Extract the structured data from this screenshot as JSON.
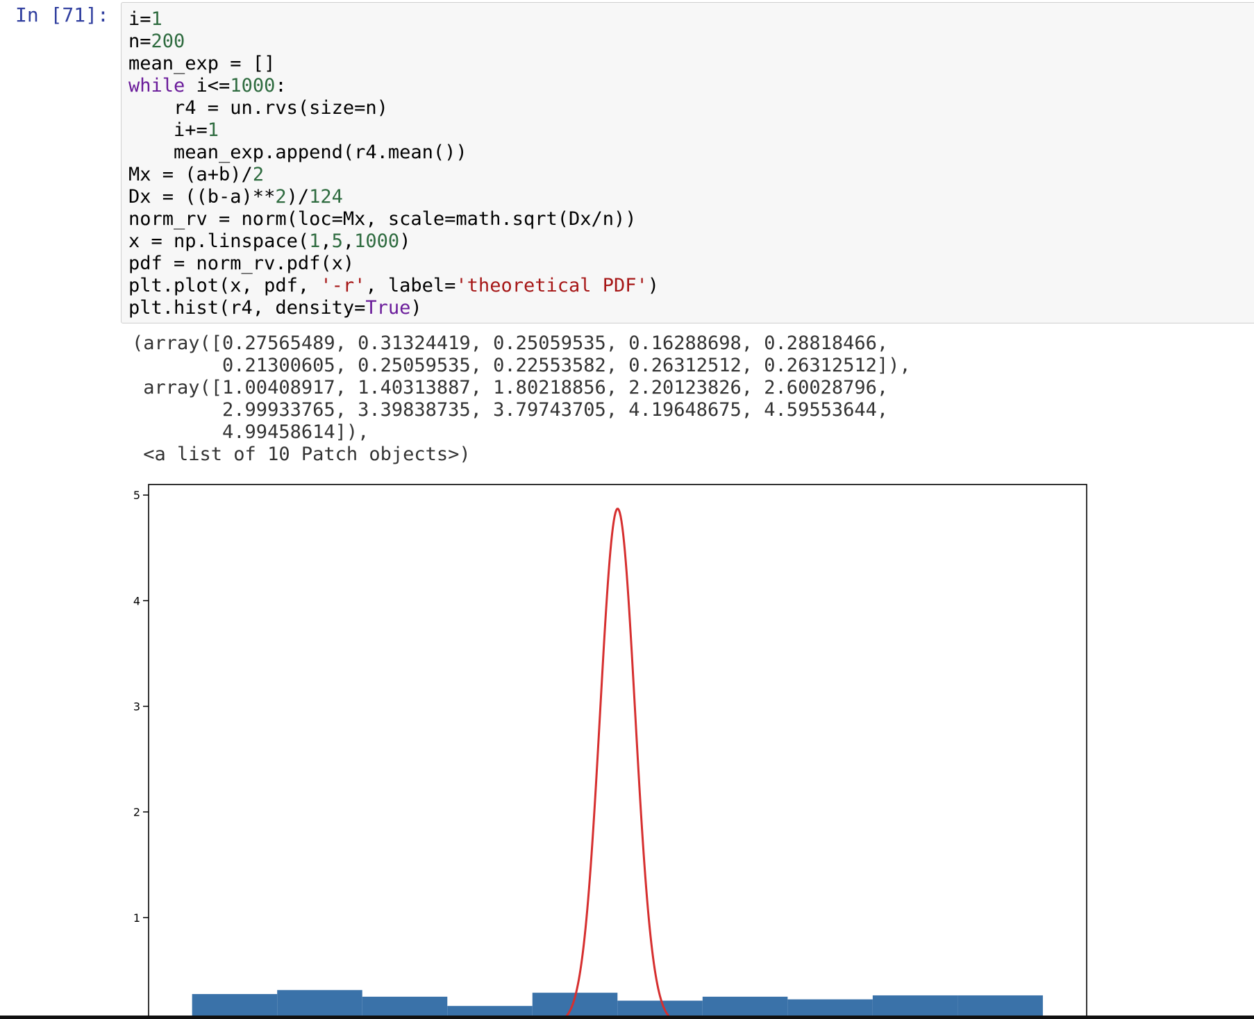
{
  "cell": {
    "prompt": "In [71]:"
  },
  "code": {
    "lines": [
      [
        {
          "t": "i="
        },
        {
          "t": "1",
          "c": "num"
        }
      ],
      [
        {
          "t": "n="
        },
        {
          "t": "200",
          "c": "num"
        }
      ],
      [
        {
          "t": "mean_exp = []"
        }
      ],
      [
        {
          "t": "while",
          "c": "kw"
        },
        {
          "t": " i<="
        },
        {
          "t": "1000",
          "c": "num"
        },
        {
          "t": ":"
        }
      ],
      [
        {
          "t": "    r4 = un.rvs(size=n)"
        }
      ],
      [
        {
          "t": "    i+="
        },
        {
          "t": "1",
          "c": "num"
        }
      ],
      [
        {
          "t": "    mean_exp.append(r4.mean())"
        }
      ],
      [
        {
          "t": "Mx = (a+b)/"
        },
        {
          "t": "2",
          "c": "num"
        }
      ],
      [
        {
          "t": "Dx = ((b-a)**"
        },
        {
          "t": "2",
          "c": "num"
        },
        {
          "t": ")/"
        },
        {
          "t": "124",
          "c": "num"
        }
      ],
      [
        {
          "t": "norm_rv = norm(loc=Mx, scale=math.sqrt(Dx/n))"
        }
      ],
      [
        {
          "t": "x = np.linspace("
        },
        {
          "t": "1",
          "c": "num"
        },
        {
          "t": ","
        },
        {
          "t": "5",
          "c": "num"
        },
        {
          "t": ","
        },
        {
          "t": "1000",
          "c": "num"
        },
        {
          "t": ")"
        }
      ],
      [
        {
          "t": "pdf = norm_rv.pdf(x)"
        }
      ],
      [
        {
          "t": "plt.plot(x, pdf, "
        },
        {
          "t": "'-r'",
          "c": "str"
        },
        {
          "t": ", label="
        },
        {
          "t": "'theoretical PDF'",
          "c": "str"
        },
        {
          "t": ")"
        }
      ],
      [
        {
          "t": "plt.hist(r4, density="
        },
        {
          "t": "True",
          "c": "kw"
        },
        {
          "t": ")"
        }
      ]
    ]
  },
  "output": {
    "lines": [
      "(array([0.27565489, 0.31324419, 0.25059535, 0.16288698, 0.28818466,",
      "        0.21300605, 0.25059535, 0.22553582, 0.26312512, 0.26312512]),",
      " array([1.00408917, 1.40313887, 1.80218856, 2.20123826, 2.60028796,",
      "        2.99933765, 3.39838735, 3.79743705, 4.19648675, 4.59553644,",
      "        4.99458614]),",
      " <a list of 10 Patch objects>)"
    ]
  },
  "chart_data": {
    "type": "bar",
    "title": "",
    "xlabel": "",
    "ylabel": "",
    "xlim": [
      0.8,
      5.2
    ],
    "ylim": [
      0,
      5.1
    ],
    "yticks": [
      0,
      1,
      2,
      3,
      4,
      5
    ],
    "ytick_labels": [
      "0",
      "1",
      "2",
      "3",
      "4",
      "5"
    ],
    "xticks": [
      1.0,
      1.5,
      2.0,
      2.5,
      3.0,
      3.5,
      4.0,
      4.5,
      5.0
    ],
    "grid": false,
    "series": [
      {
        "type": "histogram",
        "color": "#3a72a9",
        "bin_edges": [
          1.00408917,
          1.40313887,
          1.80218856,
          2.20123826,
          2.60028796,
          2.99933765,
          3.39838735,
          3.79743705,
          4.19648675,
          4.59553644,
          4.99458614
        ],
        "values": [
          0.27565489,
          0.31324419,
          0.25059535,
          0.16288698,
          0.28818466,
          0.21300605,
          0.25059535,
          0.22553582,
          0.26312512,
          0.26312512
        ]
      },
      {
        "type": "line",
        "color": "#d62f2f",
        "curve": "normal_pdf",
        "mean": 3.0,
        "std": 0.0819,
        "x_range": [
          1,
          5
        ]
      }
    ]
  }
}
